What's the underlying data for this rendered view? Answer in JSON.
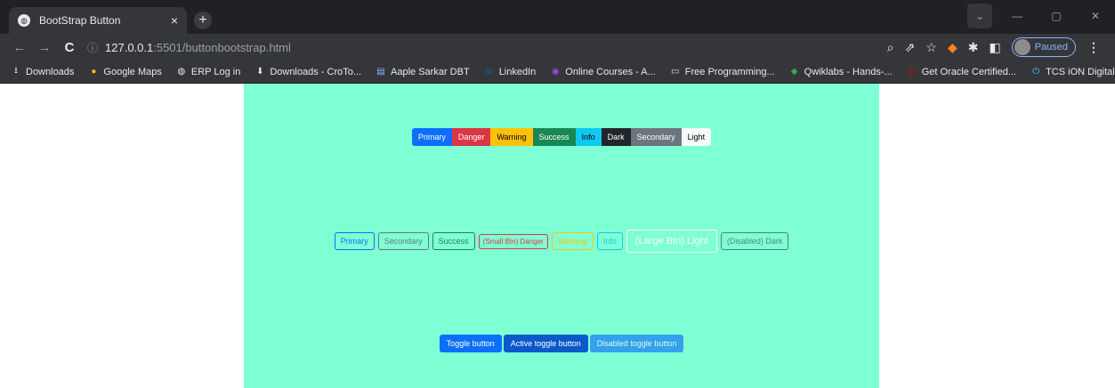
{
  "browser": {
    "tab_title": "BootStrap Button",
    "tab_close": "×",
    "new_tab": "+",
    "url_host": "127.0.0.1",
    "url_path": ":5501/buttonbootstrap.html",
    "profile_label": "Paused",
    "bookmarks": [
      {
        "label": "Downloads",
        "icon": "download-icon",
        "glyph": "⭳",
        "color": "#e8eaed"
      },
      {
        "label": "Google Maps",
        "icon": "maps-pin-icon",
        "glyph": "●",
        "color": "#fbbc04"
      },
      {
        "label": "ERP Log in",
        "icon": "globe-icon",
        "glyph": "◍",
        "color": "#e8eaed"
      },
      {
        "label": "Downloads - CroTo...",
        "icon": "download-arrow-icon",
        "glyph": "⬇",
        "color": "#e8eaed"
      },
      {
        "label": "Aaple Sarkar DBT",
        "icon": "document-icon",
        "glyph": "▤",
        "color": "#8ab4f8"
      },
      {
        "label": "LinkedIn",
        "icon": "linkedin-icon",
        "glyph": "in",
        "color": "#0a66c2"
      },
      {
        "label": "Online Courses - A...",
        "icon": "courses-icon",
        "glyph": "◉",
        "color": "#a142f4"
      },
      {
        "label": "Free Programming...",
        "icon": "screen-icon",
        "glyph": "▭",
        "color": "#e8eaed"
      },
      {
        "label": "Qwiklabs - Hands-...",
        "icon": "cloud-icon",
        "glyph": "◆",
        "color": "#34a853"
      },
      {
        "label": "Get Oracle Certified...",
        "icon": "oracle-icon",
        "glyph": "▢",
        "color": "#f80000"
      },
      {
        "label": "TCS iON Digital Lea...",
        "icon": "power-icon",
        "glyph": "⏻",
        "color": "#4fc3f7"
      }
    ],
    "bookmarks_more": "»"
  },
  "page": {
    "row1": [
      {
        "label": "Primary",
        "cls": "b-primary"
      },
      {
        "label": "Danger",
        "cls": "b-danger"
      },
      {
        "label": "Warning",
        "cls": "b-warning"
      },
      {
        "label": "Success",
        "cls": "b-success"
      },
      {
        "label": "Info",
        "cls": "b-info"
      },
      {
        "label": "Dark",
        "cls": "b-dark"
      },
      {
        "label": "Secondary",
        "cls": "b-secondary"
      },
      {
        "label": "Light",
        "cls": "b-light"
      }
    ],
    "row2": [
      {
        "label": "Primary",
        "cls": "o-primary"
      },
      {
        "label": "Secondary",
        "cls": "o-secondary"
      },
      {
        "label": "Success",
        "cls": "o-success"
      },
      {
        "label": "(Small Btn) Danger",
        "cls": "o-danger"
      },
      {
        "label": "Warning",
        "cls": "o-warning"
      },
      {
        "label": "Info",
        "cls": "o-info"
      },
      {
        "label": "(Large Btn) Light",
        "cls": "o-light"
      },
      {
        "label": "(Disabled) Dark",
        "cls": "o-dark"
      }
    ],
    "row3": [
      {
        "label": "Toggle button",
        "cls": "t-normal"
      },
      {
        "label": "Active toggle button",
        "cls": "t-active"
      },
      {
        "label": "Disabled toggle button",
        "cls": "t-disabled"
      }
    ]
  }
}
